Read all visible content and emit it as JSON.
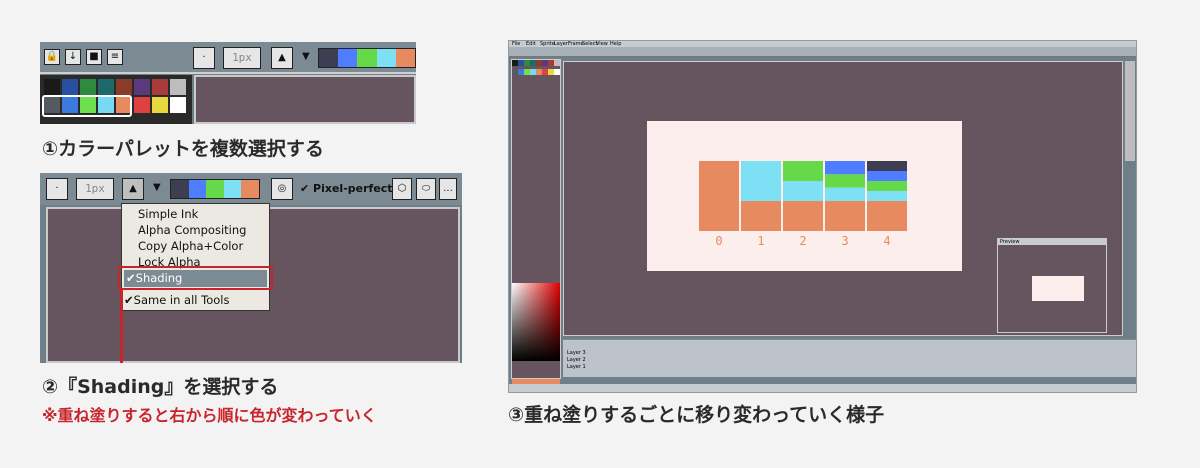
{
  "captions": {
    "step1": "①カラーパレットを複数選択する",
    "step2": "②『Shading』を選択する",
    "step2_note": "※重ね塗りすると右から順に色が変わっていく",
    "step3": "③重ね塗りするごとに移り変わっていく様子"
  },
  "toolbar": {
    "brush_size": "1px",
    "pixel_perfect_label": "Pixel-perfect",
    "ink_options_label": "..."
  },
  "ink_menu": {
    "items": [
      "Simple Ink",
      "Alpha Compositing",
      "Copy Alpha+Color",
      "Lock Alpha",
      "Shading",
      "Same in all Tools"
    ],
    "selected": "Shading"
  },
  "shading_ramp": [
    "#3e3e52",
    "#4f7dff",
    "#66d94a",
    "#7ee0f5",
    "#e88a5f"
  ],
  "palette_colors": [
    "#1a1a1a",
    "#2a4fa0",
    "#2e8a3c",
    "#1e6a6a",
    "#8a3b2a",
    "#5a3a7a",
    "#aa3b3b",
    "#bdbdbd",
    "#555a60",
    "#3d7ae0",
    "#6fe04d",
    "#78d9f2",
    "#e88a5f",
    "#e04040",
    "#e8d840",
    "#ffffff"
  ],
  "demo": {
    "stage_labels": [
      "0",
      "1",
      "2",
      "3",
      "4"
    ],
    "menu_items": [
      "File",
      "Edit",
      "Sprite",
      "Layer",
      "Frame",
      "Select",
      "View",
      "Help"
    ],
    "layers": [
      "Layer 3",
      "Layer 2",
      "Layer 1"
    ],
    "preview_title": "Preview"
  },
  "colors": {
    "accent_red": "#c8242b",
    "canvas_bg": "#66545f",
    "ui_gray": "#7c8a94"
  }
}
